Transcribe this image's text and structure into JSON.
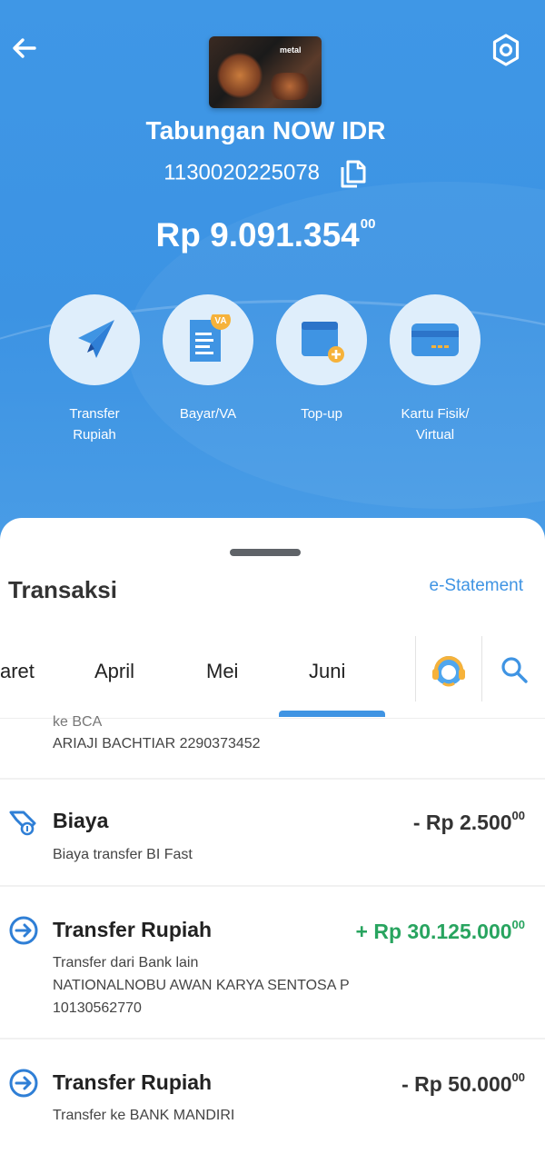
{
  "header": {
    "account_name": "Tabungan NOW IDR",
    "account_number": "1130020225078",
    "balance_main": "Rp 9.091.354",
    "balance_cents": "00",
    "card_brand": "metal"
  },
  "actions": [
    {
      "label_line1": "Transfer",
      "label_line2": "Rupiah",
      "icon": "send-icon"
    },
    {
      "label_line1": "Bayar/VA",
      "label_line2": "",
      "icon": "bill-va-icon",
      "badge": "VA"
    },
    {
      "label_line1": "Top-up",
      "label_line2": "",
      "icon": "topup-wallet-icon"
    },
    {
      "label_line1": "Kartu Fisik/",
      "label_line2": "Virtual",
      "icon": "card-icon"
    }
  ],
  "sheet": {
    "title": "Transaksi",
    "estatement": "e-Statement",
    "tabs": [
      "aret",
      "April",
      "Mei",
      "Juni"
    ],
    "active_tab": "Juni"
  },
  "transactions_partial": {
    "line1": "ke BCA",
    "line2": "ARIAJI BACHTIAR 2290373452"
  },
  "transactions": [
    {
      "title": "Biaya",
      "amount": "- Rp 2.500",
      "cents": "00",
      "type": "debit",
      "icon": "fee-icon",
      "desc": [
        "Biaya transfer BI Fast"
      ]
    },
    {
      "title": "Transfer Rupiah",
      "amount": "+ Rp 30.125.000",
      "cents": "00",
      "type": "credit",
      "icon": "transfer-in-icon",
      "desc": [
        "Transfer dari Bank lain",
        "NATIONALNOBU AWAN KARYA SENTOSA P",
        "10130562770"
      ]
    },
    {
      "title": "Transfer Rupiah",
      "amount": "- Rp 50.000",
      "cents": "00",
      "type": "debit",
      "icon": "transfer-in-icon",
      "desc": [
        "Transfer ke BANK MANDIRI"
      ]
    }
  ],
  "colors": {
    "header_blue": "#3f97e6",
    "accent_blue": "#3f94e3",
    "credit_green": "#28a45f",
    "badge_orange": "#f6b23a"
  }
}
